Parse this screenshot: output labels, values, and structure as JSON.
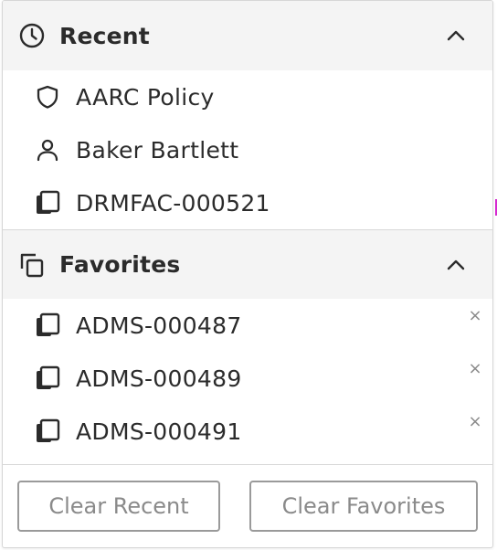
{
  "recent": {
    "title": "Recent",
    "items": [
      {
        "label": "AARC Policy",
        "icon": "shield-icon"
      },
      {
        "label": "Baker Bartlett",
        "icon": "person-icon"
      },
      {
        "label": "DRMFAC-000521",
        "icon": "document-icon"
      }
    ]
  },
  "favorites": {
    "title": "Favorites",
    "items": [
      {
        "label": "ADMS-000487",
        "icon": "document-icon",
        "remove": "×"
      },
      {
        "label": "ADMS-000489",
        "icon": "document-icon",
        "remove": "×"
      },
      {
        "label": "ADMS-000491",
        "icon": "document-icon",
        "remove": "×"
      }
    ]
  },
  "footer": {
    "clear_recent_label": "Clear Recent",
    "clear_favorites_label": "Clear Favorites"
  },
  "colors": {
    "header_bg": "#f4f4f4",
    "text": "#2b2b2b",
    "button_border": "#9a9a9a",
    "button_text": "#8a8a8a"
  }
}
